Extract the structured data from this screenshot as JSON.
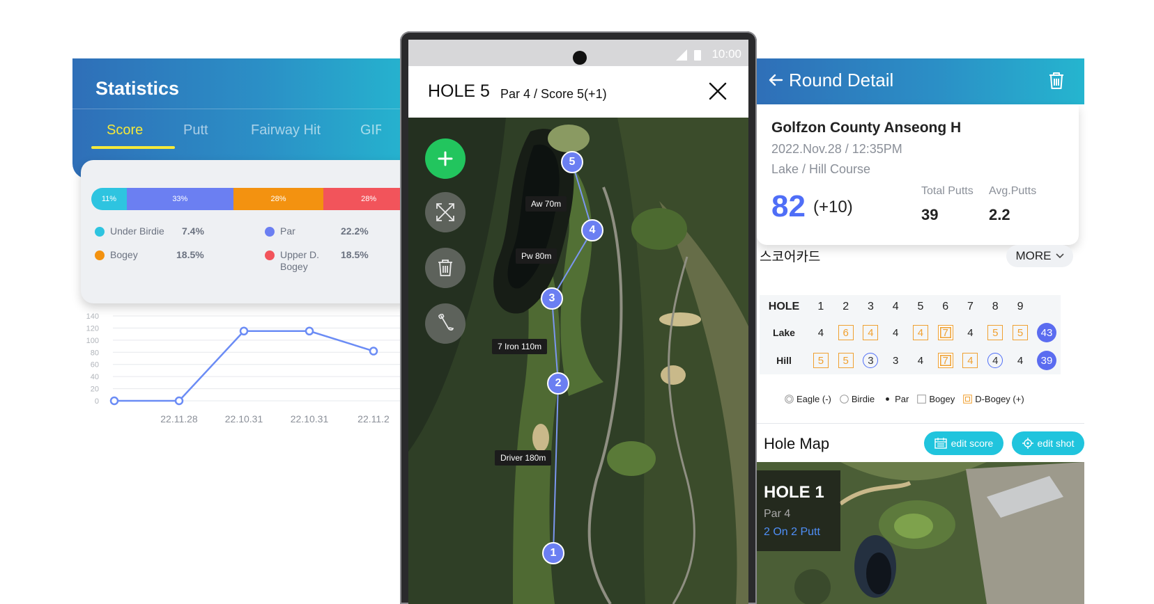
{
  "statistics": {
    "title": "Statistics",
    "tabs": [
      "Score",
      "Putt",
      "Fairway Hit",
      "GIR"
    ],
    "distribution": [
      {
        "label": "11%",
        "value": 11,
        "color": "#2ec4e0"
      },
      {
        "label": "33%",
        "value": 33,
        "color": "#6b7ff2"
      },
      {
        "label": "28%",
        "value": 28,
        "color": "#f39210"
      },
      {
        "label": "28%",
        "value": 28,
        "color": "#f2545b"
      }
    ],
    "legend": [
      {
        "name": "Under Birdie",
        "value": "7.4%",
        "color": "#2ec4e0"
      },
      {
        "name": "Par",
        "value": "22.2%",
        "color": "#6b7ff2"
      },
      {
        "name": "Bogey",
        "value": "18.5%",
        "color": "#f39210"
      },
      {
        "name": "Upper D. Bogey",
        "value": "18.5%",
        "color": "#f2545b"
      }
    ]
  },
  "chart_data": {
    "type": "line",
    "categories": [
      "",
      "22.11.28",
      "22.10.31",
      "22.10.31",
      "22.11.2"
    ],
    "values": [
      0,
      0,
      115,
      115,
      82
    ],
    "yticks": [
      0,
      20,
      40,
      60,
      80,
      100,
      120,
      140
    ],
    "ylim": [
      0,
      140
    ],
    "grid": true,
    "line_color": "#6b8cf5"
  },
  "phone": {
    "time": "10:00",
    "hole_title": "HOLE 5",
    "hole_sub": "Par 4 / Score 5(+1)",
    "shots": [
      {
        "num": "1"
      },
      {
        "num": "2"
      },
      {
        "num": "3"
      },
      {
        "num": "4"
      },
      {
        "num": "5"
      }
    ],
    "shot_labels": [
      "Aw 70m",
      "Pw 80m",
      "7 Iron 110m",
      "Driver 180m"
    ]
  },
  "round": {
    "title": "Round Detail",
    "course": "Golfzon County Anseong H",
    "date": "2022.Nov.28 / 12:35PM",
    "tee": "Lake / Hill Course",
    "score": "82",
    "diff": "(+10)",
    "total_putts_label": "Total Putts",
    "total_putts": "39",
    "avg_putts_label": "Avg.Putts",
    "avg_putts": "2.2",
    "scorecard_title": "스코어카드",
    "more": "MORE",
    "scorecard": {
      "head": [
        "HOLE",
        "1",
        "2",
        "3",
        "4",
        "5",
        "6",
        "7",
        "8",
        "9"
      ],
      "rows": [
        {
          "name": "Lake",
          "scores": [
            "4",
            "6",
            "4",
            "4",
            "4",
            "7",
            "4",
            "5",
            "5"
          ],
          "marks": [
            "par",
            "bogey",
            "bogey",
            "par",
            "bogey",
            "dbogey",
            "par",
            "bogey",
            "bogey"
          ],
          "total": "43"
        },
        {
          "name": "Hill",
          "scores": [
            "5",
            "5",
            "3",
            "3",
            "4",
            "7",
            "4",
            "4",
            "4"
          ],
          "marks": [
            "bogey",
            "bogey",
            "birdie",
            "par",
            "par",
            "dbogey",
            "bogey",
            "birdie",
            "par"
          ],
          "total": "39"
        }
      ]
    },
    "legend": [
      "Eagle (-)",
      "Birdie",
      "Par",
      "Bogey",
      "D-Bogey (+)"
    ],
    "hole_map_title": "Hole Map",
    "edit_score": "edit score",
    "edit_shot": "edit shot",
    "map_hole": "HOLE 1",
    "map_par": "Par 4",
    "map_result": "2 On 2 Putt"
  }
}
